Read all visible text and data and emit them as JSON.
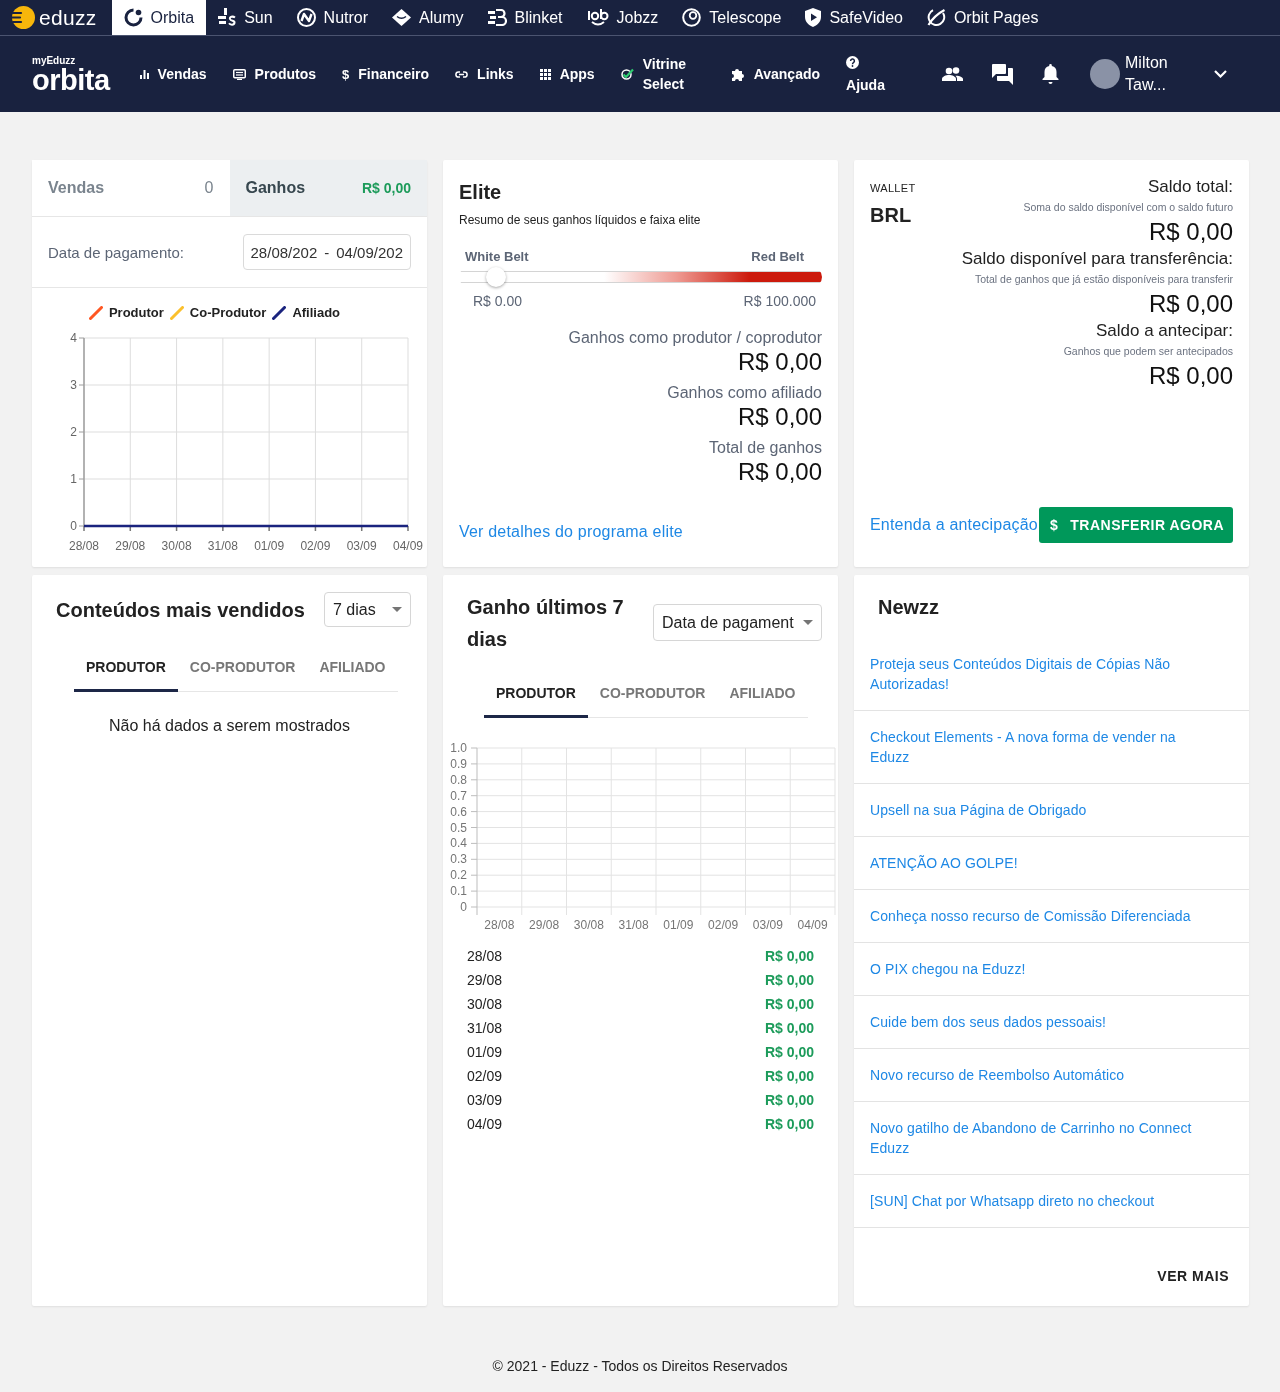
{
  "app_switcher": {
    "brand": "eduzz",
    "apps": [
      {
        "label": "Orbita",
        "selected": true
      },
      {
        "label": "Sun",
        "selected": false
      },
      {
        "label": "Nutror",
        "selected": false
      },
      {
        "label": "Alumy",
        "selected": false
      },
      {
        "label": "Blinket",
        "selected": false
      },
      {
        "label": "Jobzz",
        "selected": false
      },
      {
        "label": "Telescope",
        "selected": false
      },
      {
        "label": "SafeVideo",
        "selected": false
      },
      {
        "label": "Orbit Pages",
        "selected": false
      }
    ]
  },
  "header": {
    "logo_caption": "myEduzz",
    "logo": "orbita",
    "menu": [
      {
        "label": "Vendas",
        "kind": "inline"
      },
      {
        "label": "Produtos",
        "kind": "inline"
      },
      {
        "label": "Financeiro",
        "kind": "inline",
        "glyph": "$"
      },
      {
        "label": "Links",
        "kind": "inline"
      },
      {
        "label": "Apps",
        "kind": "inline"
      },
      {
        "label": "Vitrine Select",
        "kind": "inline"
      },
      {
        "label": "Avançado",
        "kind": "inline"
      },
      {
        "label": "Ajuda",
        "kind": "stacked"
      }
    ],
    "user": {
      "name": "Milton Taw..."
    }
  },
  "summary": {
    "tabs": [
      {
        "label": "Vendas",
        "value": "0",
        "selected": false
      },
      {
        "label": "Ganhos",
        "value": "R$ 0,00",
        "selected": true
      }
    ],
    "date_label": "Data de pagamento:",
    "date_range": {
      "start": "28/08/202",
      "separator": "-",
      "end": "04/09/202"
    },
    "chart_data": {
      "type": "line",
      "categories": [
        "28/08",
        "29/08",
        "30/08",
        "31/08",
        "01/09",
        "02/09",
        "03/09",
        "04/09"
      ],
      "series": [
        {
          "name": "Produtor",
          "color": "#ff5722",
          "values": [
            null,
            null,
            null,
            null,
            null,
            null,
            null,
            null
          ]
        },
        {
          "name": "Co-Produtor",
          "color": "#fbc02d",
          "values": [
            null,
            null,
            null,
            null,
            null,
            null,
            null,
            null
          ]
        },
        {
          "name": "Afiliado",
          "color": "#1a237e",
          "values": [
            0,
            0,
            0,
            0,
            0,
            0,
            0,
            0
          ]
        }
      ],
      "ylim": [
        0,
        4
      ],
      "yticks": [
        0,
        1,
        2,
        3,
        4
      ],
      "grid": true
    }
  },
  "elite": {
    "title": "Elite",
    "subtitle": "Resumo de seus ganhos líquidos e faixa elite",
    "belt": {
      "start_label": "White Belt",
      "end_label": "Red Belt",
      "level": 0.08,
      "min_value": "R$ 0.00",
      "max_value": "R$ 100.000"
    },
    "totals": [
      {
        "label": "Ganhos como produtor / coprodutor",
        "value": "R$ 0,00"
      },
      {
        "label": "Ganhos como afiliado",
        "value": "R$ 0,00"
      },
      {
        "label": "Total de ganhos",
        "value": "R$ 0,00"
      }
    ],
    "link": "Ver detalhes do programa elite"
  },
  "wallet": {
    "label": "WALLET",
    "currency": "BRL",
    "balances": [
      {
        "title": "Saldo total:",
        "hint": "Soma do saldo disponível com o saldo futuro",
        "value": "R$ 0,00"
      },
      {
        "title": "Saldo disponível para transferência:",
        "hint": "Total de ganhos que já estão disponíveis para transferir",
        "value": "R$ 0,00"
      },
      {
        "title": "Saldo a antecipar:",
        "hint": "Ganhos que podem ser antecipados",
        "value": "R$ 0,00"
      }
    ],
    "link": "Entenda a antecipação",
    "button": {
      "glyph": "$",
      "label": "TRANSFERIR AGORA"
    }
  },
  "top_products": {
    "title": "Conteúdos mais vendidos",
    "period": "7 dias",
    "tabs": [
      {
        "label": "PRODUTOR",
        "selected": true
      },
      {
        "label": "CO-PRODUTOR",
        "selected": false
      },
      {
        "label": "AFILIADO",
        "selected": false
      }
    ],
    "empty_message": "Não há dados a serem mostrados"
  },
  "earnings": {
    "title": "Ganho últimos 7 dias",
    "date_basis": "Data de pagament",
    "tabs": [
      {
        "label": "PRODUTOR",
        "selected": true
      },
      {
        "label": "CO-PRODUTOR",
        "selected": false
      },
      {
        "label": "AFILIADO",
        "selected": false
      }
    ],
    "chart_data": {
      "type": "bar",
      "categories": [
        "28/08",
        "29/08",
        "30/08",
        "31/08",
        "01/09",
        "02/09",
        "03/09",
        "04/09"
      ],
      "values": [
        0,
        0,
        0,
        0,
        0,
        0,
        0,
        0
      ],
      "ylim": [
        0,
        1
      ],
      "yticks": [
        0,
        0.1,
        0.2,
        0.3,
        0.4,
        0.5,
        0.6,
        0.7,
        0.8,
        0.9,
        {
          "value": 1,
          "label": "1.0"
        }
      ],
      "grid": true
    },
    "rows": [
      {
        "date": "28/08",
        "amount": "R$ 0,00"
      },
      {
        "date": "29/08",
        "amount": "R$ 0,00"
      },
      {
        "date": "30/08",
        "amount": "R$ 0,00"
      },
      {
        "date": "31/08",
        "amount": "R$ 0,00"
      },
      {
        "date": "01/09",
        "amount": "R$ 0,00"
      },
      {
        "date": "02/09",
        "amount": "R$ 0,00"
      },
      {
        "date": "03/09",
        "amount": "R$ 0,00"
      },
      {
        "date": "04/09",
        "amount": "R$ 0,00"
      }
    ]
  },
  "news": {
    "title": "Newzz",
    "items": [
      "Proteja seus Conteúdos Digitais de Cópias Não Autorizadas!",
      "Checkout Elements - A nova forma de vender na Eduzz",
      "Upsell na sua Página de Obrigado",
      "ATENÇÃO AO GOLPE!",
      "Conheça nosso recurso de Comissão Diferenciada",
      "O PIX chegou na Eduzz!",
      "Cuide bem dos seus dados pessoais!",
      "Novo recurso de Reembolso Automático",
      "Novo gatilho de Abandono de Carrinho no Connect Eduzz",
      "[SUN] Chat por Whatsapp direto no checkout"
    ],
    "more": "VER MAIS"
  },
  "footer": "© 2021 - Eduzz - Todos os Direitos Reservados"
}
